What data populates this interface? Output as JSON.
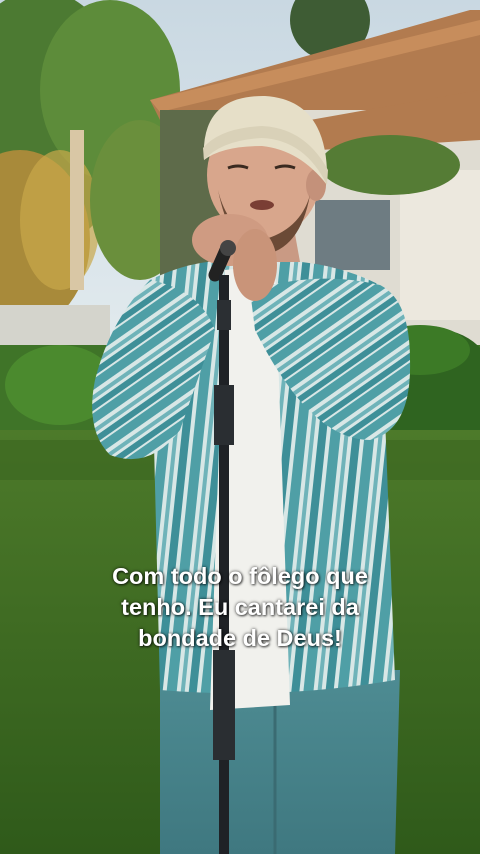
{
  "video": {
    "subtitle_lines": [
      "Com todo o fôlego que",
      "tenho. Eu cantarei da",
      "bondade de Deus!"
    ]
  }
}
